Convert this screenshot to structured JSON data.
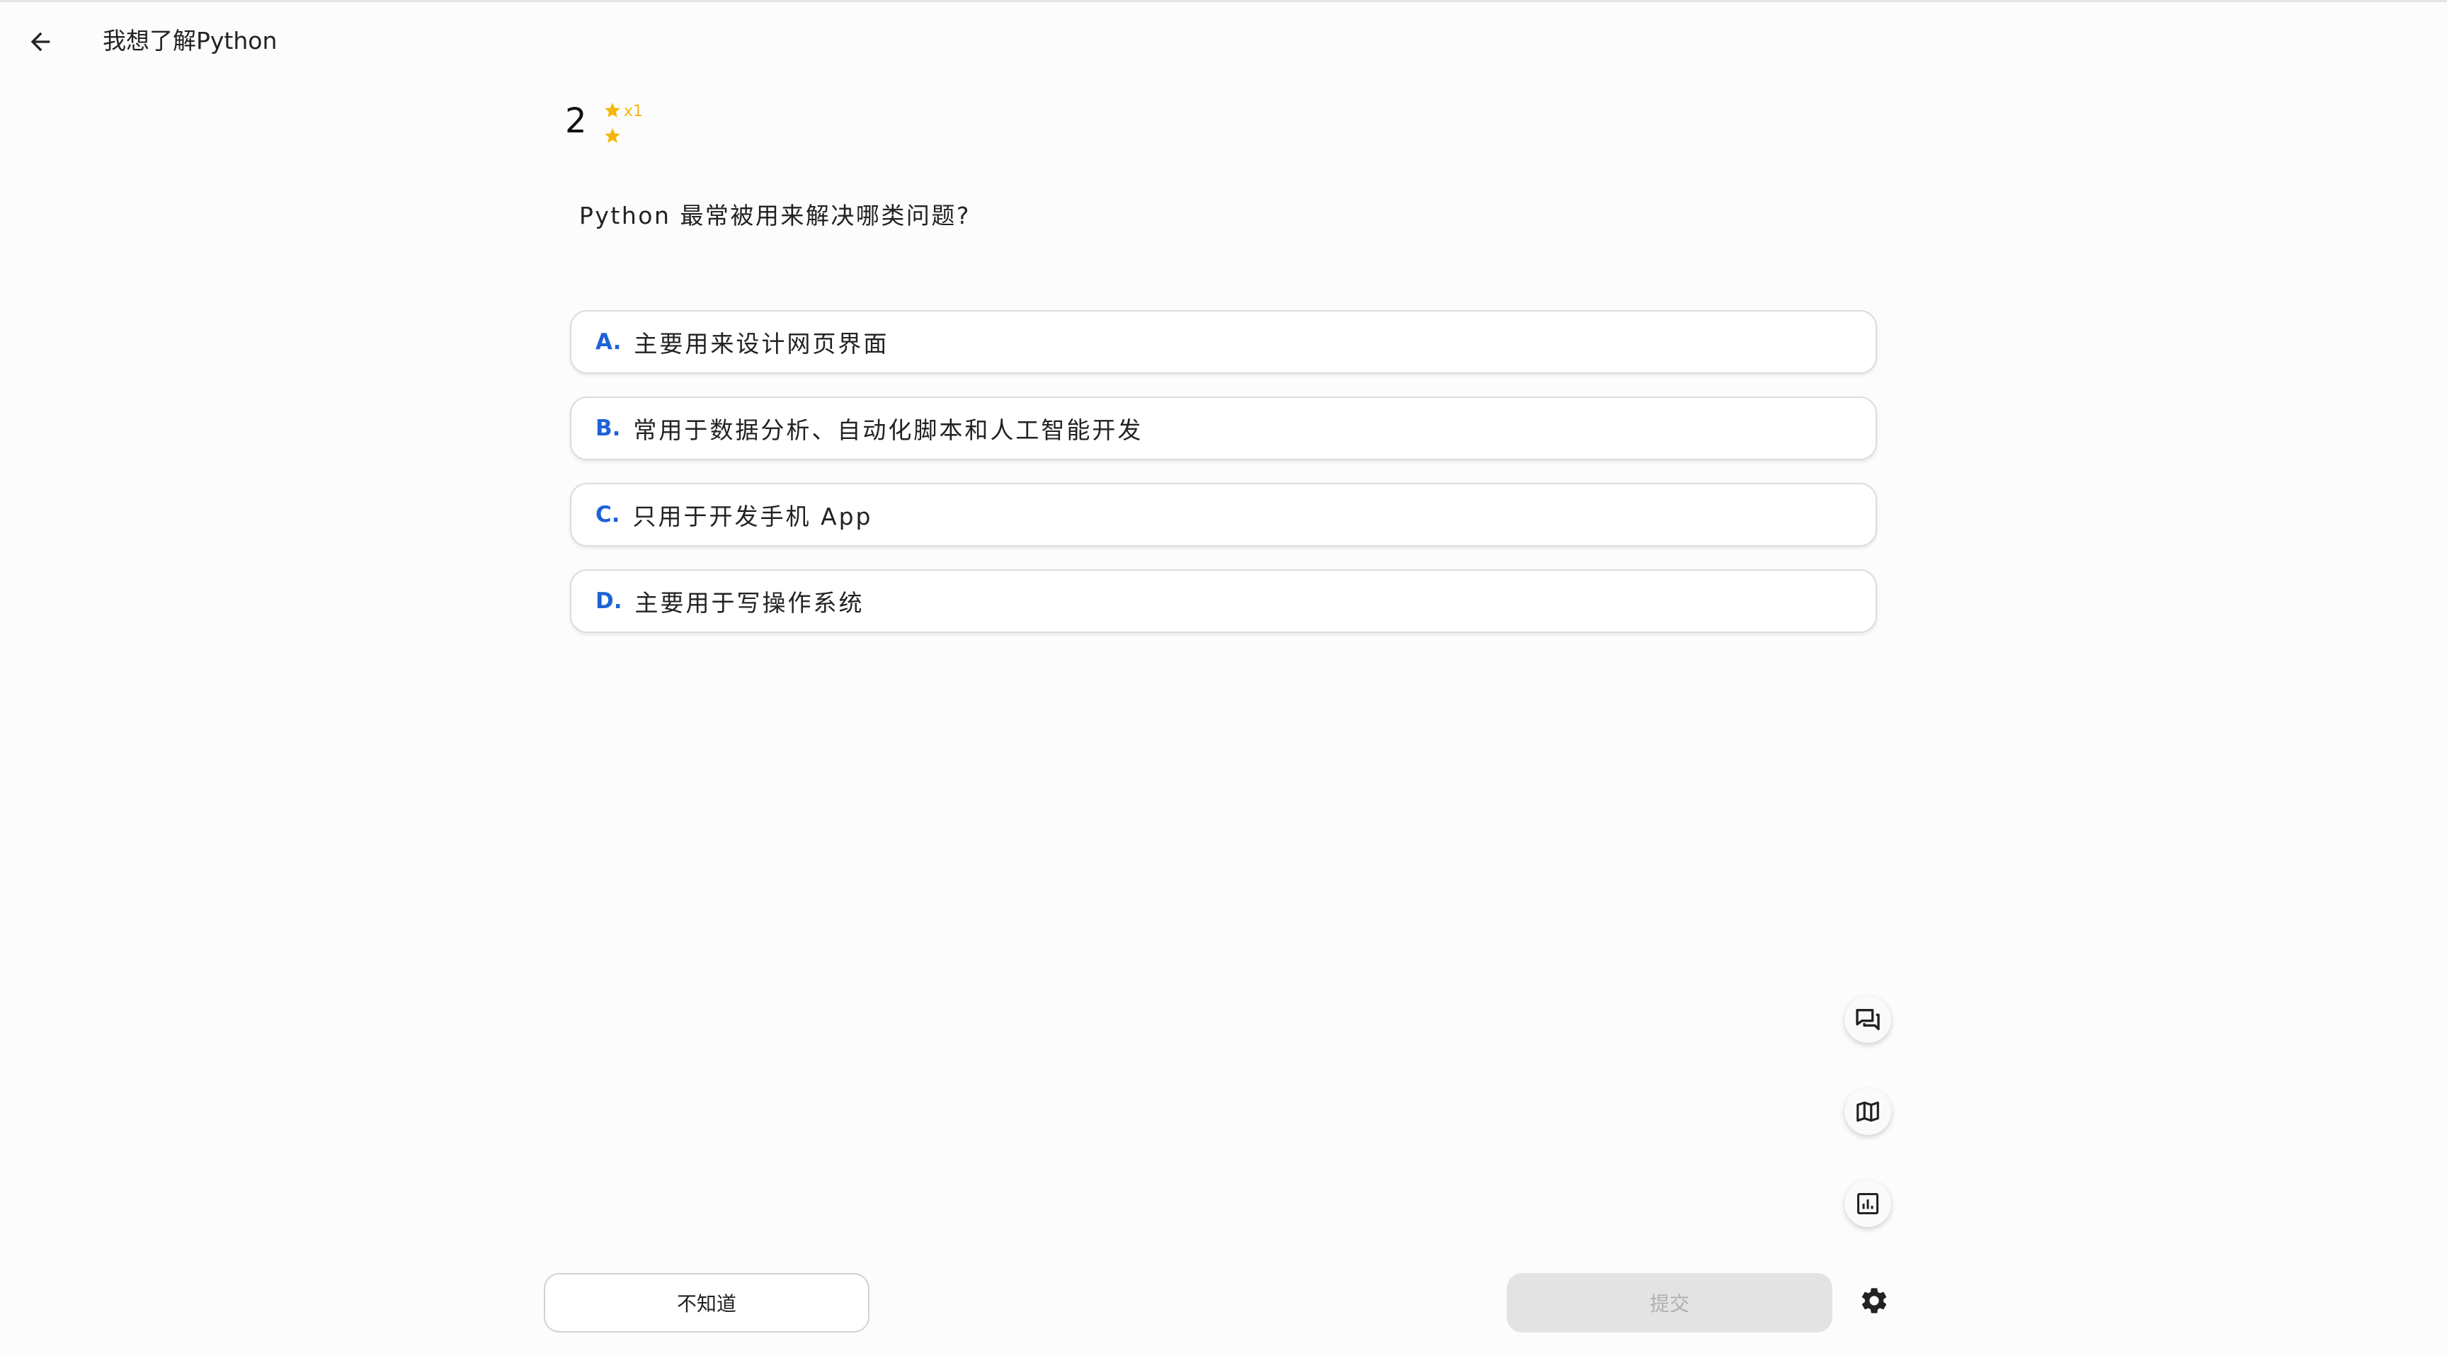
{
  "header": {
    "back_icon": "arrow-left-icon",
    "title": "我想了解Python"
  },
  "question": {
    "number": "2",
    "star_multiplier": "x1",
    "star_color": "#f5b50a",
    "text": "Python 最常被用来解决哪类问题?"
  },
  "options": [
    {
      "letter": "A.",
      "text": "主要用来设计网页界面"
    },
    {
      "letter": "B.",
      "text": "常用于数据分析、自动化脚本和人工智能开发"
    },
    {
      "letter": "C.",
      "text": "只用于开发手机 App"
    },
    {
      "letter": "D.",
      "text": "主要用于写操作系统"
    }
  ],
  "side_tools": [
    {
      "icon": "chat-icon"
    },
    {
      "icon": "map-icon"
    },
    {
      "icon": "report-icon"
    }
  ],
  "footer": {
    "dont_know_label": "不知道",
    "submit_label": "提交",
    "settings_icon": "gear-icon"
  },
  "colors": {
    "accent": "#1e63d6",
    "star": "#f5b50a",
    "submit_disabled_bg": "#e3e3e3"
  }
}
